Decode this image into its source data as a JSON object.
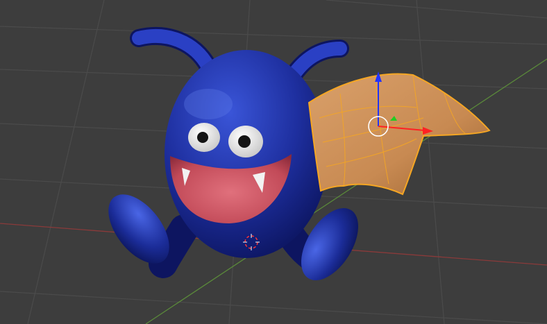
{
  "viewport": {
    "background": "#3d3d3d",
    "grid_color": "#4a4a4a",
    "x_axis_color": "#8a3a3a",
    "y_axis_color": "#5a8a3a"
  },
  "scene": {
    "objects": [
      {
        "name": "body",
        "color": "#1f2f9a"
      },
      {
        "name": "wing",
        "color": "#c8894a",
        "selected": true,
        "outline_color": "#f5a623"
      }
    ]
  },
  "gizmo": {
    "z_axis_color": "#2233ff",
    "x_axis_color": "#ff2222",
    "y_axis_color": "#22cc22",
    "pivot_color": "#ffffff"
  },
  "cursor_3d": {
    "icon": "crosshair-icon",
    "colors": [
      "#ff3333",
      "#ffffff"
    ]
  }
}
